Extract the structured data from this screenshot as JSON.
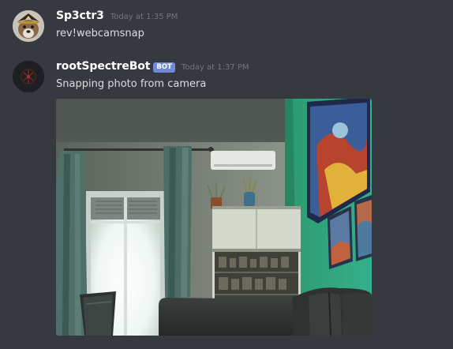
{
  "messages": [
    {
      "username": "Sp3ctr3",
      "timestamp": "Today at 1:35 PM",
      "content": "rev!webcamsnap",
      "avatar_icon": "dog-avatar-icon"
    },
    {
      "username": "rootSpectreBot",
      "bot_tag": "BOT",
      "timestamp": "Today at 1:37 PM",
      "content": "Snapping photo from camera",
      "avatar_icon": "red-logo-avatar-icon",
      "attachment": "webcam-photo"
    }
  ],
  "colors": {
    "background": "#36393f",
    "username": "#ffffff",
    "message_text": "#dcddde",
    "timestamp": "#72767d",
    "bot_tag": "#7289da"
  }
}
